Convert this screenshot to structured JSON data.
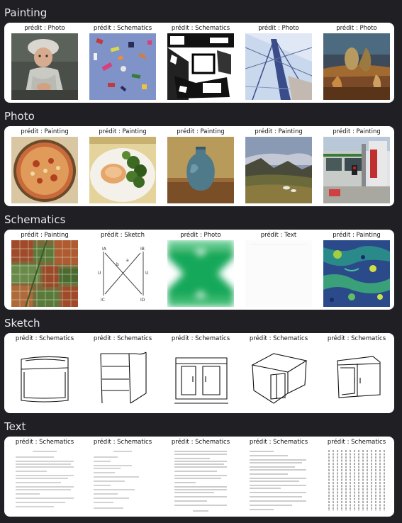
{
  "sections": [
    {
      "title": "Painting",
      "predictions": [
        "prédit : Photo",
        "prédit : Schematics",
        "prédit : Schematics",
        "prédit : Photo",
        "prédit : Photo"
      ]
    },
    {
      "title": "Photo",
      "predictions": [
        "prédit : Painting",
        "prédit : Painting",
        "prédit : Painting",
        "prédit : Painting",
        "prédit : Painting"
      ]
    },
    {
      "title": "Schematics",
      "predictions": [
        "prédit : Painting",
        "prédit : Sketch",
        "prédit : Photo",
        "prédit : Text",
        "prédit : Painting"
      ]
    },
    {
      "title": "Sketch",
      "predictions": [
        "prédit : Schematics",
        "prédit : Schematics",
        "prédit : Schematics",
        "prédit : Schematics",
        "prédit : Schematics"
      ]
    },
    {
      "title": "Text",
      "predictions": [
        "prédit : Schematics",
        "prédit : Schematics",
        "prédit : Schematics",
        "prédit : Schematics",
        "prédit : Schematics"
      ]
    }
  ],
  "diagram_labels": {
    "top_left": "IA",
    "top_right": "IB",
    "bottom_left": "IC",
    "bottom_right": "ID",
    "mid_left": "U",
    "mid_right": "U",
    "center_left": "b",
    "center_right": "a"
  }
}
